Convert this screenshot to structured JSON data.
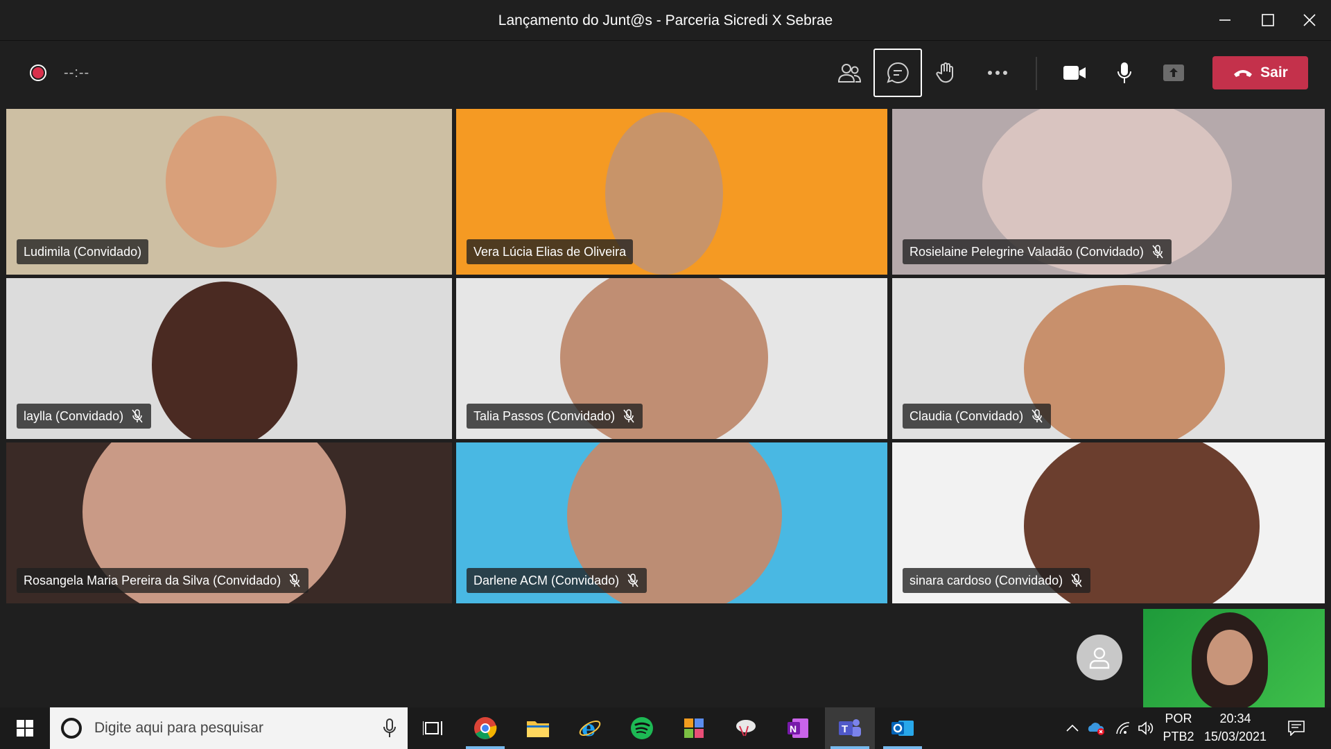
{
  "window": {
    "title": "Lançamento do Junt@s - Parceria Sicredi X Sebrae"
  },
  "toolbar": {
    "timer": "--:--",
    "leave_label": "Sair",
    "buttons": [
      "participants-icon",
      "chat-icon",
      "raise-hand-icon",
      "more-options-icon",
      "camera-icon",
      "microphone-icon",
      "share-screen-icon"
    ]
  },
  "participants": [
    {
      "name": "Ludimila (Convidado)",
      "muted": false,
      "bg": "#cfc2a6"
    },
    {
      "name": "Vera Lúcia Elias de Oliveira",
      "muted": false,
      "bg": "#f59a23"
    },
    {
      "name": "Rosielaine Pelegrine Valadão (Convidado)",
      "muted": true,
      "bg": "#b9aeb1"
    },
    {
      "name": "laylla (Convidado)",
      "muted": true,
      "bg": "#dcdcdc"
    },
    {
      "name": "Talia Passos (Convidado)",
      "muted": true,
      "bg": "#e6e6e6"
    },
    {
      "name": "Claudia (Convidado)",
      "muted": true,
      "bg": "#e2e2e2"
    },
    {
      "name": "Rosangela Maria Pereira da Silva (Convidado)",
      "muted": true,
      "bg": "#3a2a26"
    },
    {
      "name": "Darlene ACM (Convidado)",
      "muted": true,
      "bg": "#49b8e3"
    },
    {
      "name": "sinara cardoso (Convidado)",
      "muted": true,
      "bg": "#f2f2f2"
    }
  ],
  "taskbar": {
    "search_placeholder": "Digite aqui para pesquisar",
    "apps": [
      "task-view-icon",
      "chrome-icon",
      "file-explorer-icon",
      "internet-explorer-icon",
      "spotify-icon",
      "app-icon",
      "app-icon",
      "onenote-icon",
      "teams-icon",
      "outlook-icon"
    ],
    "lang_line1": "POR",
    "lang_line2": "PTB2",
    "time": "20:34",
    "date": "15/03/2021"
  },
  "colors": {
    "accent_leave": "#c4314b",
    "recording": "#d9304c"
  }
}
